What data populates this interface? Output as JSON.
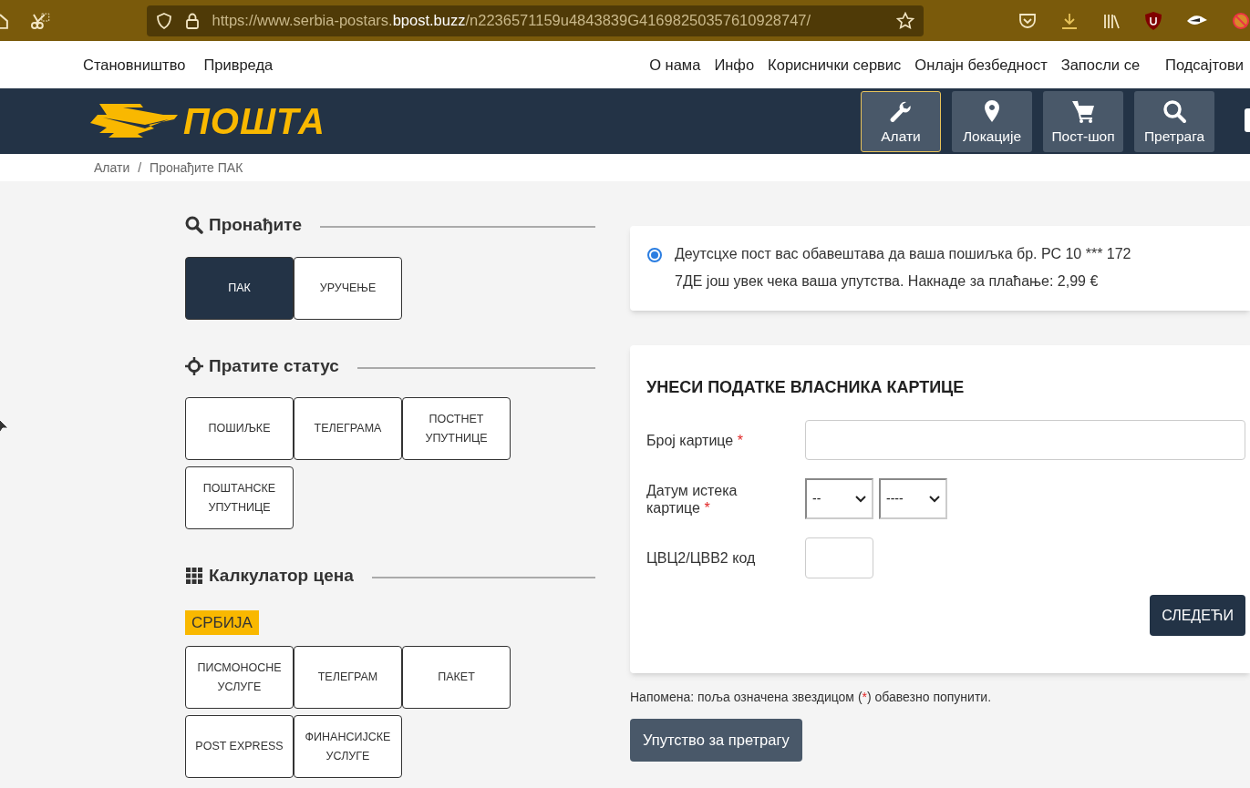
{
  "browser": {
    "url_prefix": "https://www.serbia-postars.",
    "url_domain": "bpost.buzz",
    "url_suffix": "/n2236571159u4843839G41698250357610928747/"
  },
  "top_nav": {
    "left": [
      "Становништво",
      "Привреда"
    ],
    "right": [
      "О нама",
      "Инфо",
      "Кориснички сервис",
      "Онлајн безбедност",
      "Запосли се",
      "Подсајтови"
    ]
  },
  "header": {
    "logo_text": "ПОШТА",
    "tools": [
      {
        "label": "Алати",
        "selected": true
      },
      {
        "label": "Локације",
        "selected": false
      },
      {
        "label": "Пост-шоп",
        "selected": false
      },
      {
        "label": "Претрага",
        "selected": false
      }
    ]
  },
  "breadcrumb": {
    "separator": "/",
    "items": [
      "Алати",
      "Пронађите ПАК"
    ]
  },
  "sections": [
    {
      "title": "Пронађите",
      "items": [
        {
          "label": "ПАК",
          "selected": true
        },
        {
          "label": "УРУЧЕЊЕ",
          "selected": false
        }
      ]
    },
    {
      "title": "Пратите статус",
      "items": [
        {
          "label": "ПОШИЉКЕ",
          "selected": false
        },
        {
          "label": "ТЕЛЕГРАМА",
          "selected": false
        },
        {
          "label": "ПОСТНЕТ УПУТНИЦЕ",
          "selected": false
        },
        {
          "label": "ПОШТАНСКЕ УПУТНИЦЕ",
          "selected": false
        }
      ]
    },
    {
      "title": "Калкулатор цена",
      "tag": "СРБИЈА",
      "items": [
        {
          "label": "ПИСМОНОСНЕ УСЛУГЕ",
          "selected": false
        },
        {
          "label": "ТЕЛЕГРАМ",
          "selected": false
        },
        {
          "label": "ПАКЕТ",
          "selected": false
        },
        {
          "label": "POST EXPRESS",
          "selected": false
        },
        {
          "label": "ФИНАНСИЈСКЕ УСЛУГЕ",
          "selected": false
        }
      ]
    }
  ],
  "notice": {
    "checked": true,
    "text": "Деутсцхе пост вас обавештава да ваша пошиљка бр. РС 10 *** 172 7ДЕ још увек чека ваша упутства. Накнаде за плаћање: 2,99 €"
  },
  "form": {
    "title": "УНЕСИ ПОДАТКЕ ВЛАСНИКА КАРТИЦЕ",
    "fields": [
      {
        "kind": "text",
        "label": "Број картице",
        "required_mark": "*"
      },
      {
        "kind": "selects",
        "label": "Датум истека картице",
        "required_mark": "*",
        "options": [
          "--",
          "----"
        ]
      },
      {
        "kind": "short",
        "label": "ЦВЦ2/ЦВВ2 код"
      }
    ],
    "submit": "СЛЕДЕЋИ"
  },
  "note": {
    "before": "Напомена: поља означена звездицом (",
    "mark": "*",
    "after": ") обавезно попунити."
  },
  "help_button": "Упутство за претрагу"
}
